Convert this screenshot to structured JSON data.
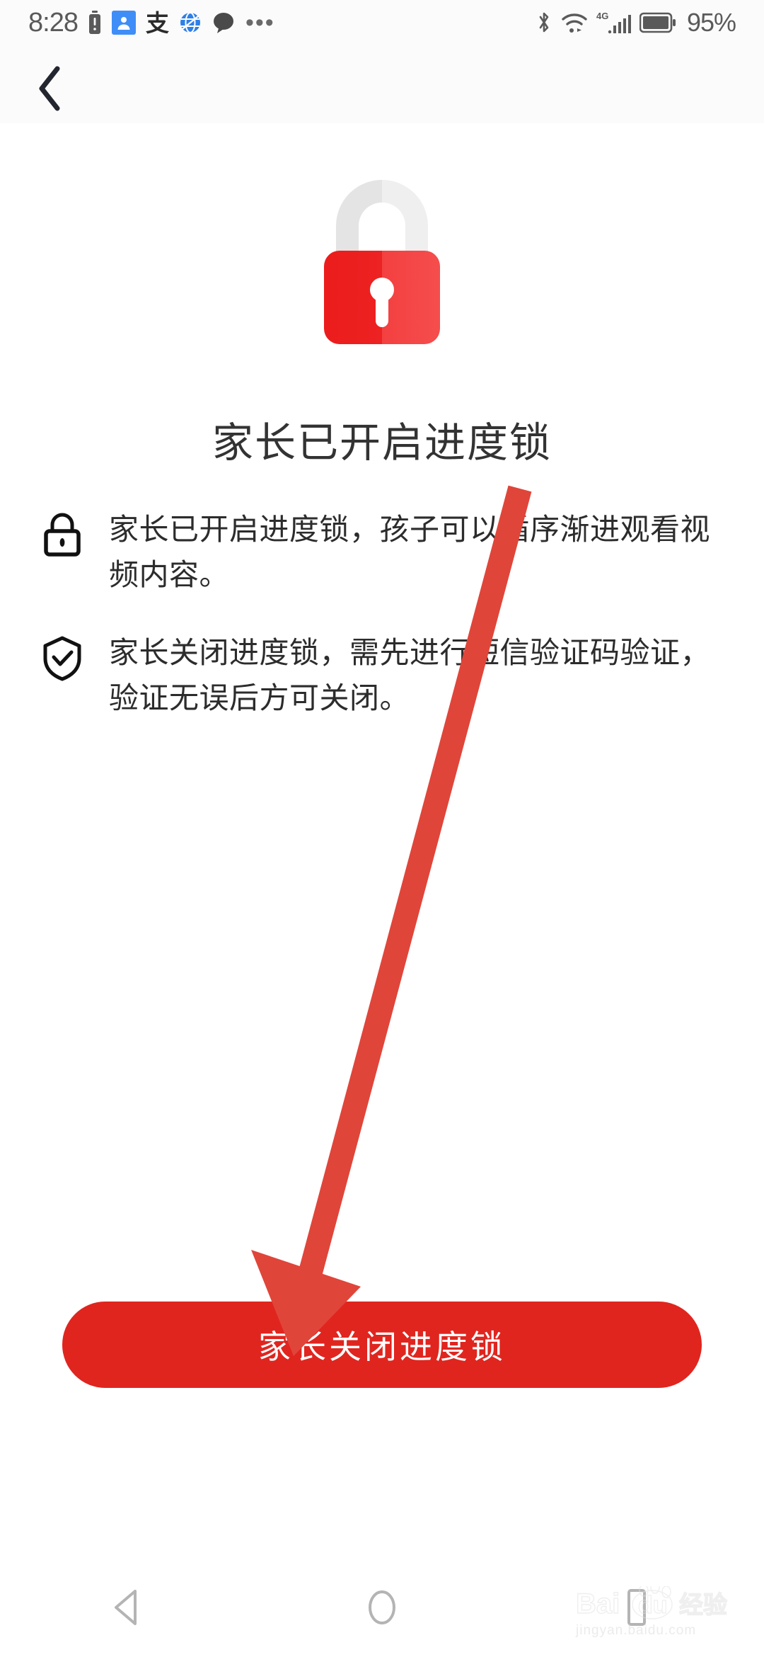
{
  "status_bar": {
    "time": "8:28",
    "battery_percent": "95%",
    "network_type": "4G",
    "left_icons": [
      "battery-alert-icon",
      "contact-person-icon",
      "alipay-icon",
      "browser-globe-icon",
      "chat-bubble-icon",
      "more-dots-icon"
    ],
    "right_icons": [
      "bluetooth-icon",
      "wifi-icon",
      "signal-bars-icon",
      "battery-icon"
    ],
    "alipay_glyph": "支",
    "more_glyph": "•••"
  },
  "navigation": {
    "back_icon": "chevron-left-icon"
  },
  "hero": {
    "icon": "padlock-locked-icon",
    "title": "家长已开启进度锁"
  },
  "info_items": [
    {
      "icon": "padlock-outline-icon",
      "text": "家长已开启进度锁，孩子可以循序渐进观看视频内容。"
    },
    {
      "icon": "shield-check-icon",
      "text": "家长关闭进度锁，需先进行短信验证码验证，验证无误后方可关闭。"
    }
  ],
  "primary_button": {
    "label": "家长关闭进度锁"
  },
  "annotation": {
    "type": "arrow",
    "color": "#e0453a",
    "points_to": "primary-button"
  },
  "bottom_nav": {
    "items": [
      "back-triangle-icon",
      "home-circle-icon",
      "recents-square-icon"
    ]
  },
  "watermark": {
    "brand": "Baidu",
    "brand_cn": "经验",
    "url": "jingyan.baidu.com"
  },
  "colors": {
    "accent_red": "#e0251f",
    "lock_body_red": "#ee2828",
    "lock_shackle_gray": "#e8e8e8",
    "status_text": "#5a5a5a",
    "title_text": "#333333",
    "body_text": "#2c2c2c",
    "annotation_red": "#e0453a"
  }
}
